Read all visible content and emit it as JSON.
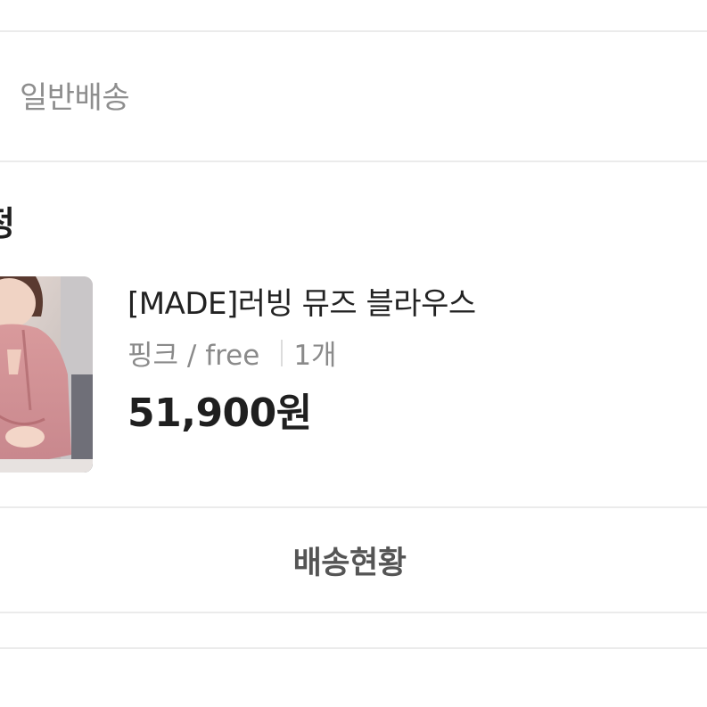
{
  "shipping": {
    "type_label": "일반배송"
  },
  "section": {
    "title_fragment": "정"
  },
  "product": {
    "thumbnail_icon": "product-photo-pink-blouse",
    "name": "[MADE]러빙 뮤즈 블라우스",
    "option": "핑크 / free",
    "quantity": "1개",
    "price": "51,900원"
  },
  "actions": {
    "delivery_status_label": "배송현황"
  },
  "colors": {
    "divider": "#ebebeb",
    "text_primary": "#1f1f1f",
    "text_secondary": "#8a8a8a",
    "button_text": "#555555"
  }
}
